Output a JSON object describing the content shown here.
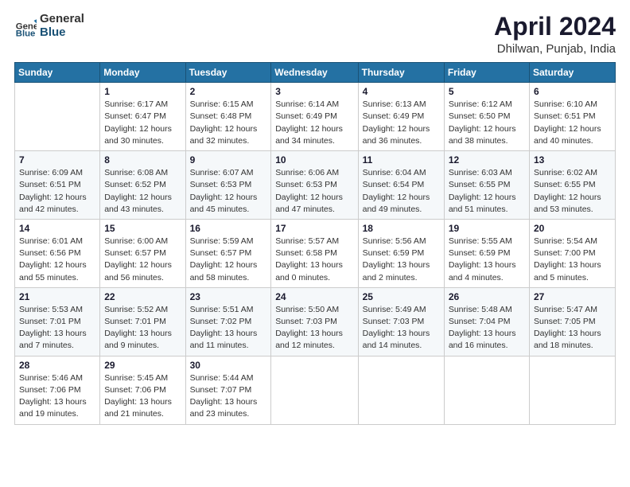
{
  "logo": {
    "general": "General",
    "blue": "Blue"
  },
  "title": "April 2024",
  "subtitle": "Dhilwan, Punjab, India",
  "days_header": [
    "Sunday",
    "Monday",
    "Tuesday",
    "Wednesday",
    "Thursday",
    "Friday",
    "Saturday"
  ],
  "weeks": [
    [
      {
        "num": "",
        "info": ""
      },
      {
        "num": "1",
        "info": "Sunrise: 6:17 AM\nSunset: 6:47 PM\nDaylight: 12 hours\nand 30 minutes."
      },
      {
        "num": "2",
        "info": "Sunrise: 6:15 AM\nSunset: 6:48 PM\nDaylight: 12 hours\nand 32 minutes."
      },
      {
        "num": "3",
        "info": "Sunrise: 6:14 AM\nSunset: 6:49 PM\nDaylight: 12 hours\nand 34 minutes."
      },
      {
        "num": "4",
        "info": "Sunrise: 6:13 AM\nSunset: 6:49 PM\nDaylight: 12 hours\nand 36 minutes."
      },
      {
        "num": "5",
        "info": "Sunrise: 6:12 AM\nSunset: 6:50 PM\nDaylight: 12 hours\nand 38 minutes."
      },
      {
        "num": "6",
        "info": "Sunrise: 6:10 AM\nSunset: 6:51 PM\nDaylight: 12 hours\nand 40 minutes."
      }
    ],
    [
      {
        "num": "7",
        "info": "Sunrise: 6:09 AM\nSunset: 6:51 PM\nDaylight: 12 hours\nand 42 minutes."
      },
      {
        "num": "8",
        "info": "Sunrise: 6:08 AM\nSunset: 6:52 PM\nDaylight: 12 hours\nand 43 minutes."
      },
      {
        "num": "9",
        "info": "Sunrise: 6:07 AM\nSunset: 6:53 PM\nDaylight: 12 hours\nand 45 minutes."
      },
      {
        "num": "10",
        "info": "Sunrise: 6:06 AM\nSunset: 6:53 PM\nDaylight: 12 hours\nand 47 minutes."
      },
      {
        "num": "11",
        "info": "Sunrise: 6:04 AM\nSunset: 6:54 PM\nDaylight: 12 hours\nand 49 minutes."
      },
      {
        "num": "12",
        "info": "Sunrise: 6:03 AM\nSunset: 6:55 PM\nDaylight: 12 hours\nand 51 minutes."
      },
      {
        "num": "13",
        "info": "Sunrise: 6:02 AM\nSunset: 6:55 PM\nDaylight: 12 hours\nand 53 minutes."
      }
    ],
    [
      {
        "num": "14",
        "info": "Sunrise: 6:01 AM\nSunset: 6:56 PM\nDaylight: 12 hours\nand 55 minutes."
      },
      {
        "num": "15",
        "info": "Sunrise: 6:00 AM\nSunset: 6:57 PM\nDaylight: 12 hours\nand 56 minutes."
      },
      {
        "num": "16",
        "info": "Sunrise: 5:59 AM\nSunset: 6:57 PM\nDaylight: 12 hours\nand 58 minutes."
      },
      {
        "num": "17",
        "info": "Sunrise: 5:57 AM\nSunset: 6:58 PM\nDaylight: 13 hours\nand 0 minutes."
      },
      {
        "num": "18",
        "info": "Sunrise: 5:56 AM\nSunset: 6:59 PM\nDaylight: 13 hours\nand 2 minutes."
      },
      {
        "num": "19",
        "info": "Sunrise: 5:55 AM\nSunset: 6:59 PM\nDaylight: 13 hours\nand 4 minutes."
      },
      {
        "num": "20",
        "info": "Sunrise: 5:54 AM\nSunset: 7:00 PM\nDaylight: 13 hours\nand 5 minutes."
      }
    ],
    [
      {
        "num": "21",
        "info": "Sunrise: 5:53 AM\nSunset: 7:01 PM\nDaylight: 13 hours\nand 7 minutes."
      },
      {
        "num": "22",
        "info": "Sunrise: 5:52 AM\nSunset: 7:01 PM\nDaylight: 13 hours\nand 9 minutes."
      },
      {
        "num": "23",
        "info": "Sunrise: 5:51 AM\nSunset: 7:02 PM\nDaylight: 13 hours\nand 11 minutes."
      },
      {
        "num": "24",
        "info": "Sunrise: 5:50 AM\nSunset: 7:03 PM\nDaylight: 13 hours\nand 12 minutes."
      },
      {
        "num": "25",
        "info": "Sunrise: 5:49 AM\nSunset: 7:03 PM\nDaylight: 13 hours\nand 14 minutes."
      },
      {
        "num": "26",
        "info": "Sunrise: 5:48 AM\nSunset: 7:04 PM\nDaylight: 13 hours\nand 16 minutes."
      },
      {
        "num": "27",
        "info": "Sunrise: 5:47 AM\nSunset: 7:05 PM\nDaylight: 13 hours\nand 18 minutes."
      }
    ],
    [
      {
        "num": "28",
        "info": "Sunrise: 5:46 AM\nSunset: 7:06 PM\nDaylight: 13 hours\nand 19 minutes."
      },
      {
        "num": "29",
        "info": "Sunrise: 5:45 AM\nSunset: 7:06 PM\nDaylight: 13 hours\nand 21 minutes."
      },
      {
        "num": "30",
        "info": "Sunrise: 5:44 AM\nSunset: 7:07 PM\nDaylight: 13 hours\nand 23 minutes."
      },
      {
        "num": "",
        "info": ""
      },
      {
        "num": "",
        "info": ""
      },
      {
        "num": "",
        "info": ""
      },
      {
        "num": "",
        "info": ""
      }
    ]
  ]
}
